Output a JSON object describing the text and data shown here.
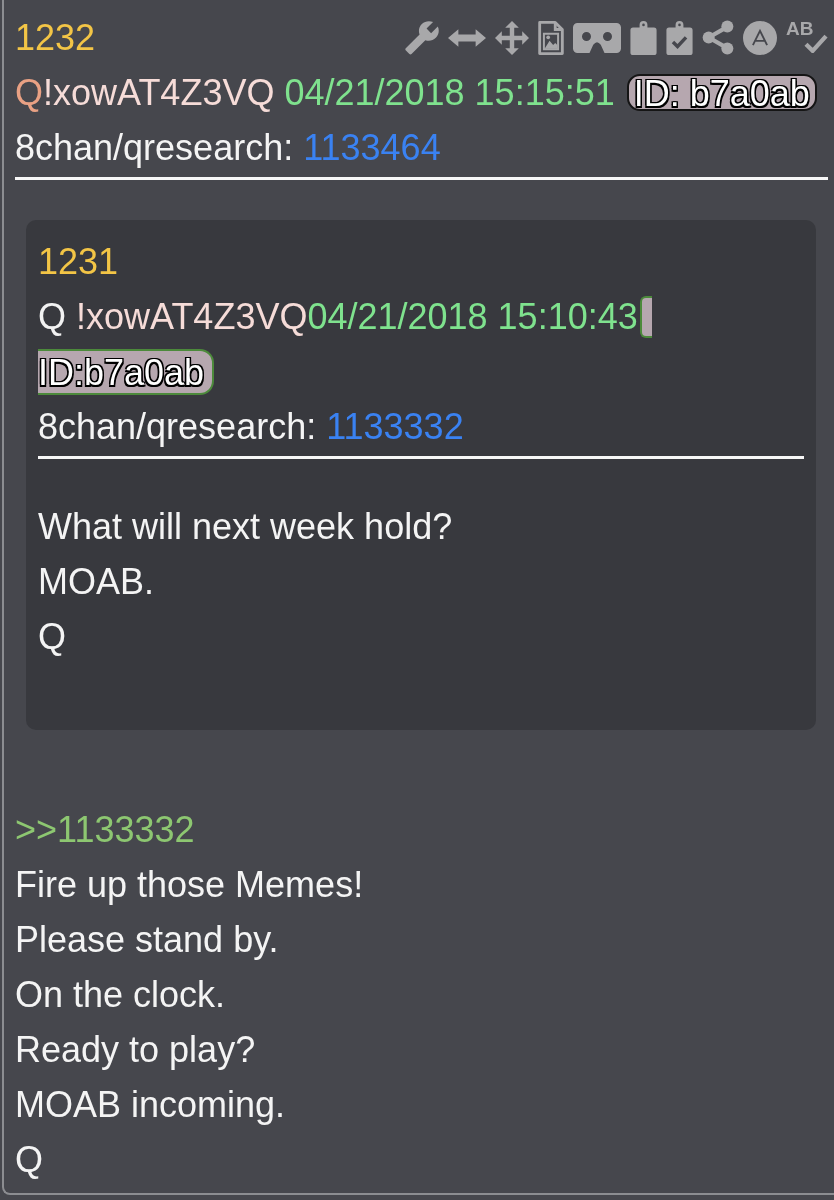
{
  "post_number": "1232",
  "toolbar": {
    "spellcheck_label": "AB"
  },
  "author": {
    "name": "Q",
    "tripcode": "!xowAT4Z3VQ"
  },
  "timestamp": "04/21/2018 15:15:51",
  "id_badge": "ID: b7a0ab",
  "source": {
    "board": "8chan/qresearch:",
    "post_link": "1133464"
  },
  "quoted_post": {
    "number": "1231",
    "author": {
      "name": "Q",
      "tripcode": "!xowAT4Z3VQ"
    },
    "timestamp": "04/21/2018 15:10:43",
    "id_badge": "ID:b7a0ab",
    "source": {
      "board": "8chan/qresearch:",
      "post_link": "1133332"
    },
    "body": [
      "What will next week hold?",
      "MOAB.",
      "Q"
    ]
  },
  "reply_link": ">>1133332",
  "body": [
    "Fire up those Memes!",
    "Please stand by.",
    "On the clock.",
    "Ready to play?",
    "MOAB incoming.",
    "Q"
  ]
}
